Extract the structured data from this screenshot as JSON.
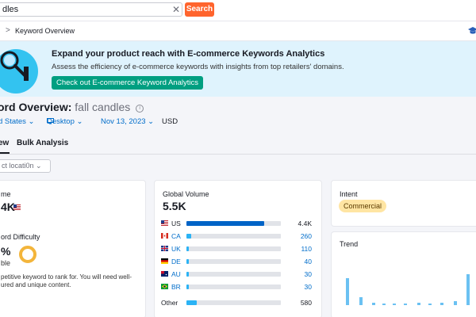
{
  "search": {
    "value": "dles",
    "clear_symbol": "✕",
    "button_label": "Search"
  },
  "breadcrumb": {
    "separator": ">",
    "label": "Keyword Overview"
  },
  "banner": {
    "title": "Expand your product reach with E-commerce Keywords Analytics",
    "subtitle": "Assess the efficiency of e-commerce keywords with insights from top retailers' domains.",
    "cta_label": "Check out E-commerce Keyword Analytics"
  },
  "header": {
    "title_prefix": "ord Overview:",
    "keyword": "fall candles",
    "info_symbol": "i"
  },
  "filters": {
    "country": "d States ⌄",
    "device": "Desktop ⌄",
    "date": "Nov 13, 2023 ⌄",
    "currency": "USD"
  },
  "tabs": [
    {
      "label": "ew"
    },
    {
      "label": "Bulk Analysis"
    }
  ],
  "location_select": {
    "label": "ct locati0n ⌄"
  },
  "volume_card": {
    "label": "me",
    "value": "4K"
  },
  "difficulty": {
    "label": "ord Difficulty",
    "value": "%",
    "level": "ble",
    "desc_line1": "petitive keyword to rank for. You will need well-",
    "desc_line2": "ured and unique content."
  },
  "global_volume": {
    "label": "Global Volume",
    "value": "5.5K",
    "rows": [
      {
        "code": "US",
        "value": "4.4K",
        "share": 0.82,
        "flag": "us"
      },
      {
        "code": "CA",
        "value": "260",
        "share": 0.05,
        "flag": "ca"
      },
      {
        "code": "UK",
        "value": "110",
        "share": 0.02,
        "flag": "uk"
      },
      {
        "code": "DE",
        "value": "40",
        "share": 0.01,
        "flag": "de"
      },
      {
        "code": "AU",
        "value": "30",
        "share": 0.01,
        "flag": "au"
      },
      {
        "code": "BR",
        "value": "30",
        "share": 0.01,
        "flag": "br"
      },
      {
        "code": "Other",
        "value": "580",
        "share": 0.11,
        "flag": ""
      }
    ]
  },
  "intent": {
    "label": "Intent",
    "badge": "Commercial"
  },
  "trend": {
    "label": "Trend",
    "values": [
      0.78,
      0.22,
      0.06,
      0.04,
      0.04,
      0.04,
      0.06,
      0.05,
      0.06,
      0.12,
      0.88
    ]
  },
  "colors": {
    "accent_orange": "#ff642d",
    "cta_green": "#009f81",
    "link_blue": "#006dca",
    "bar_blue": "#0063c6",
    "bar_light": "#2bb3f5",
    "badge_yellow": "#ffe5a3"
  }
}
